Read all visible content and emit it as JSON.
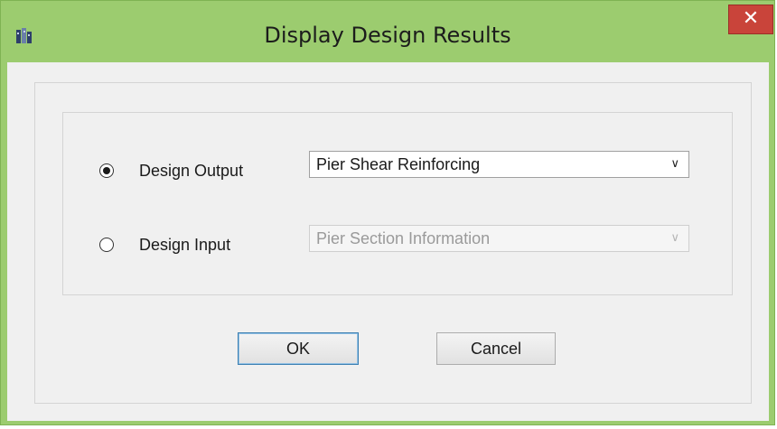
{
  "window": {
    "title": "Display Design Results",
    "close_glyph": "✕",
    "app_icon": "etabs-icon"
  },
  "options": {
    "design_output": {
      "label": "Design Output",
      "selected": true,
      "value": "Pier Shear Reinforcing",
      "enabled": true
    },
    "design_input": {
      "label": "Design Input",
      "selected": false,
      "value": "Pier Section Information",
      "enabled": false
    }
  },
  "buttons": {
    "ok": "OK",
    "cancel": "Cancel"
  },
  "icons": {
    "dropdown": "chevron-down-icon",
    "close": "close-icon"
  },
  "colors": {
    "titlebar": "#9ccc6f",
    "close": "#c9443a",
    "dialog_bg": "#f0f0f0"
  }
}
